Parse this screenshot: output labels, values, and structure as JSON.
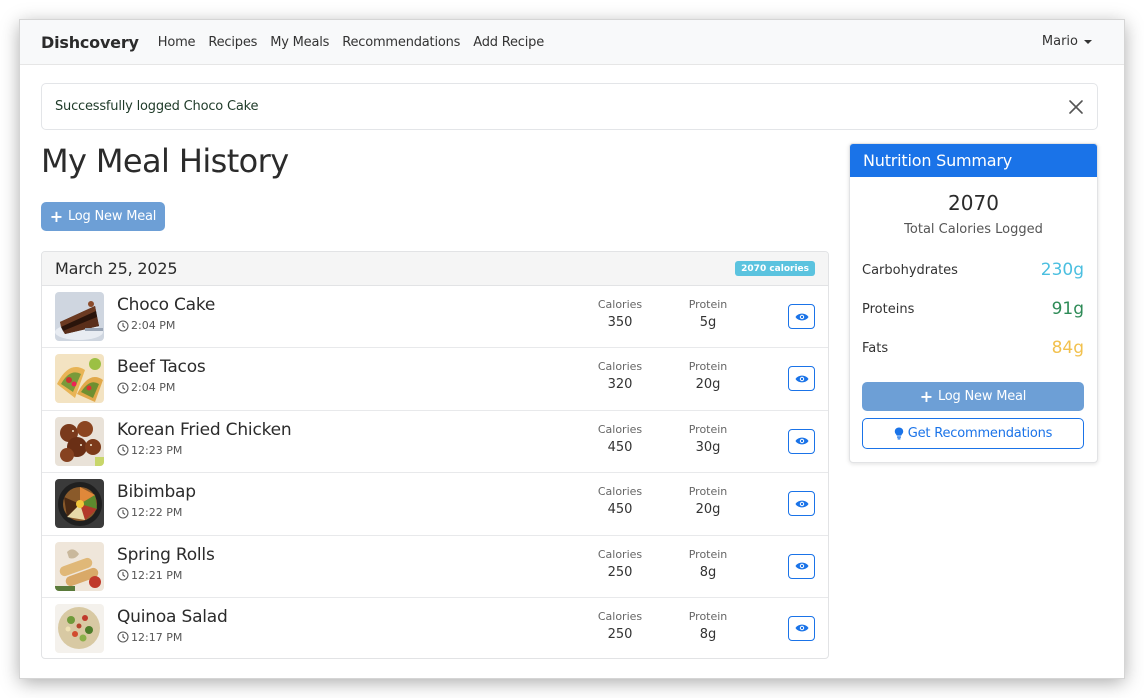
{
  "nav": {
    "brand": "Dishcovery",
    "links": [
      "Home",
      "Recipes",
      "My Meals",
      "Recommendations",
      "Add Recipe"
    ],
    "user": "Mario"
  },
  "alert": {
    "message": "Successfully logged Choco Cake"
  },
  "page": {
    "title": "My Meal History",
    "log_button": "Log New Meal"
  },
  "meals_card": {
    "date": "March 25, 2025",
    "badge": "2070 calories",
    "calories_label": "Calories",
    "protein_label": "Protein",
    "meals": [
      {
        "name": "Choco Cake",
        "time": "2:04 PM",
        "calories": "350",
        "protein": "5g"
      },
      {
        "name": "Beef Tacos",
        "time": "2:04 PM",
        "calories": "320",
        "protein": "20g"
      },
      {
        "name": "Korean Fried Chicken",
        "time": "12:23 PM",
        "calories": "450",
        "protein": "30g"
      },
      {
        "name": "Bibimbap",
        "time": "12:22 PM",
        "calories": "450",
        "protein": "20g"
      },
      {
        "name": "Spring Rolls",
        "time": "12:21 PM",
        "calories": "250",
        "protein": "8g"
      },
      {
        "name": "Quinoa Salad",
        "time": "12:17 PM",
        "calories": "250",
        "protein": "8g"
      }
    ]
  },
  "nutrition": {
    "title": "Nutrition Summary",
    "total": "2070",
    "total_label": "Total Calories Logged",
    "macros": [
      {
        "label": "Carbohydrates",
        "value": "230g",
        "color": "#4bbfe0"
      },
      {
        "label": "Proteins",
        "value": "91g",
        "color": "#2e8b57"
      },
      {
        "label": "Fats",
        "value": "84g",
        "color": "#f2c14e"
      }
    ],
    "log_button": "Log New Meal",
    "reco_button": "Get Recommendations"
  },
  "colors": {
    "primary": "#1a73e8",
    "primary_light": "#6d9fd6",
    "badge": "#5bc3df"
  },
  "icons": [
    "close-icon",
    "plus-icon",
    "clock-icon",
    "eye-icon",
    "lightbulb-icon",
    "caret-down-icon"
  ]
}
